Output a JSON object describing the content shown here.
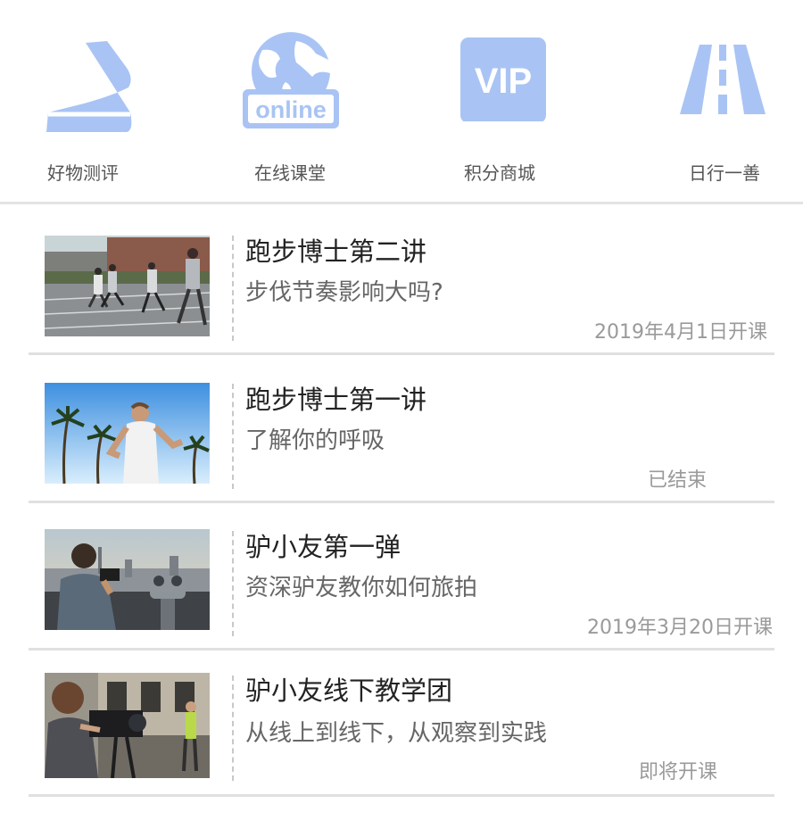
{
  "nav": {
    "items": [
      {
        "label": "好物测评",
        "icon": "sneaker-icon"
      },
      {
        "label": "在线课堂",
        "icon": "globe-online-icon",
        "badge_text": "online"
      },
      {
        "label": "积分商城",
        "icon": "vip-icon",
        "badge_text": "VIP"
      },
      {
        "label": "日行一善",
        "icon": "road-icon"
      }
    ],
    "icon_color": "#a9c4f4"
  },
  "courses": [
    {
      "title": "跑步博士第二讲",
      "subtitle": "步伐节奏影响大吗?",
      "status": "2019年4月1日开课",
      "thumb": "runners-photo"
    },
    {
      "title": "跑步博士第一讲",
      "subtitle": "了解你的呼吸",
      "status": "已结束",
      "thumb": "runner-palms-photo"
    },
    {
      "title": "驴小友第一弹",
      "subtitle": "资深驴友教你如何旅拍",
      "status": "2019年3月20日开课",
      "thumb": "city-photographer-photo"
    },
    {
      "title": "驴小友线下教学团",
      "subtitle": "从线上到线下，从观察到实践",
      "status": "即将开课",
      "thumb": "camera-crew-photo"
    }
  ]
}
